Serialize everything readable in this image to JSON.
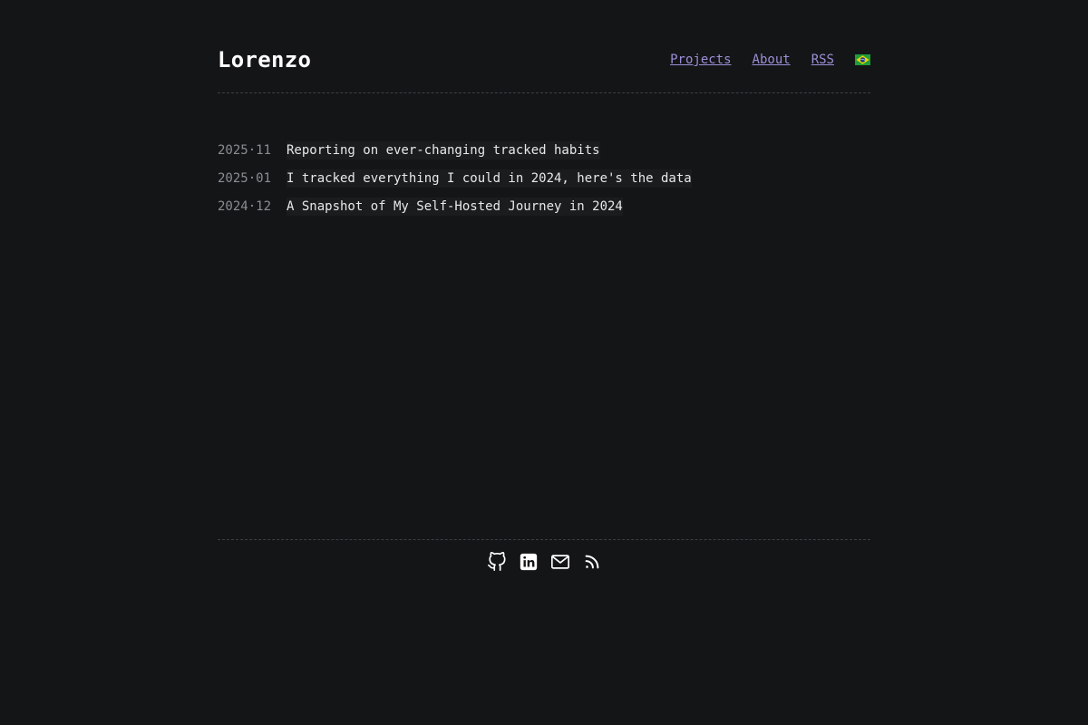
{
  "site": {
    "title": "Lorenzo"
  },
  "nav": {
    "items": [
      {
        "label": "Projects"
      },
      {
        "label": "About"
      },
      {
        "label": "RSS"
      }
    ],
    "language_flag": "brazil-flag-icon"
  },
  "posts": [
    {
      "date": "2025·11",
      "title": "Reporting on ever-changing tracked habits"
    },
    {
      "date": "2025·01",
      "title": "I tracked everything I could in 2024, here's the data"
    },
    {
      "date": "2024·12",
      "title": "A Snapshot of My Self-Hosted Journey in 2024"
    }
  ],
  "footer": {
    "social_icons": [
      "github-icon",
      "linkedin-icon",
      "mail-icon",
      "rss-icon"
    ]
  },
  "colors": {
    "background": "#141517",
    "link": "#9a8fd6",
    "text": "#e6e6e6",
    "muted": "#8a8d92"
  }
}
